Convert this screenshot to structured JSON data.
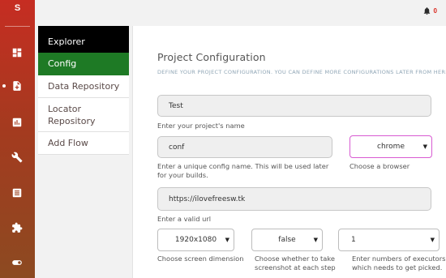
{
  "app": {
    "brand_letter": "S"
  },
  "notifications": {
    "count": "0"
  },
  "submenu": {
    "header": "Explorer",
    "items": [
      "Config",
      "Data Repository",
      "Locator Repository",
      "Add Flow"
    ]
  },
  "page": {
    "title": "Project Configuration",
    "subtitle": "DEFINE YOUR PROJECT CONFIGURATION. YOU CAN DEFINE MORE CONFIGURATIONS LATER FROM HERE."
  },
  "form": {
    "project_name": {
      "value": "Test",
      "hint": "Enter your project's name"
    },
    "config_name": {
      "value": "conf",
      "hint": "Enter a unique config name. This will be used later for your builds."
    },
    "browser": {
      "value": "chrome",
      "hint": "Choose a browser"
    },
    "url": {
      "value": "https://ilovefreesw.tk",
      "hint": "Enter a valid url"
    },
    "screen": {
      "value": "1920x1080",
      "hint": "Choose screen dimension"
    },
    "screenshot": {
      "value": "false",
      "hint": "Choose whether to take screenshot at each step"
    },
    "executors": {
      "value": "1",
      "hint": "Enter numbers of executors which needs to get picked."
    }
  },
  "colors": {
    "rail_top": "#c62d22",
    "rail_bottom": "#8c4a21",
    "active": "#1e7a25",
    "browser_border": "#d85bd2"
  }
}
